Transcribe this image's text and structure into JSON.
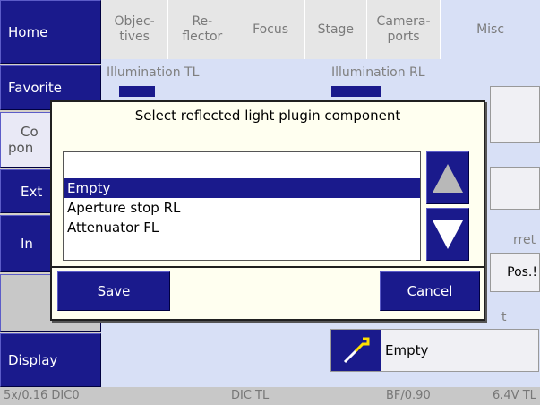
{
  "nav": {
    "home": "Home",
    "favorite": "Favorite",
    "components_1": "Co",
    "components_2": "pon",
    "ext": "Ext",
    "in": "In",
    "display": "Display"
  },
  "tabs": [
    {
      "line1": "Objec-",
      "line2": "tives"
    },
    {
      "line1": "Re-",
      "line2": "flector"
    },
    {
      "line1": "Focus",
      "line2": ""
    },
    {
      "line1": "Stage",
      "line2": ""
    },
    {
      "line1": "Camera-",
      "line2": "ports"
    },
    {
      "line1": "Misc",
      "line2": ""
    }
  ],
  "content": {
    "illum_tl_label": "Illumination TL",
    "illum_rl_label": "Illumination RL",
    "turret_fragment": "rret",
    "pos_fragment": "Pos.!",
    "reflected_fragment": "t",
    "component_value": "Empty"
  },
  "dialog": {
    "title": "Select reflected light plugin component",
    "items": [
      "Empty",
      "Aperture stop RL",
      "Attenuator FL"
    ],
    "selected_index": 0,
    "save_label": "Save",
    "cancel_label": "Cancel"
  },
  "status": {
    "objective": "5x/0.16 DIC0",
    "tl": "DIC TL",
    "rl": "BF/0.90",
    "voltage": "6.4V TL"
  },
  "colors": {
    "button_blue": "#1a1a8c",
    "content_bg": "#d8e0f6",
    "dialog_bg": "#fffff0"
  }
}
